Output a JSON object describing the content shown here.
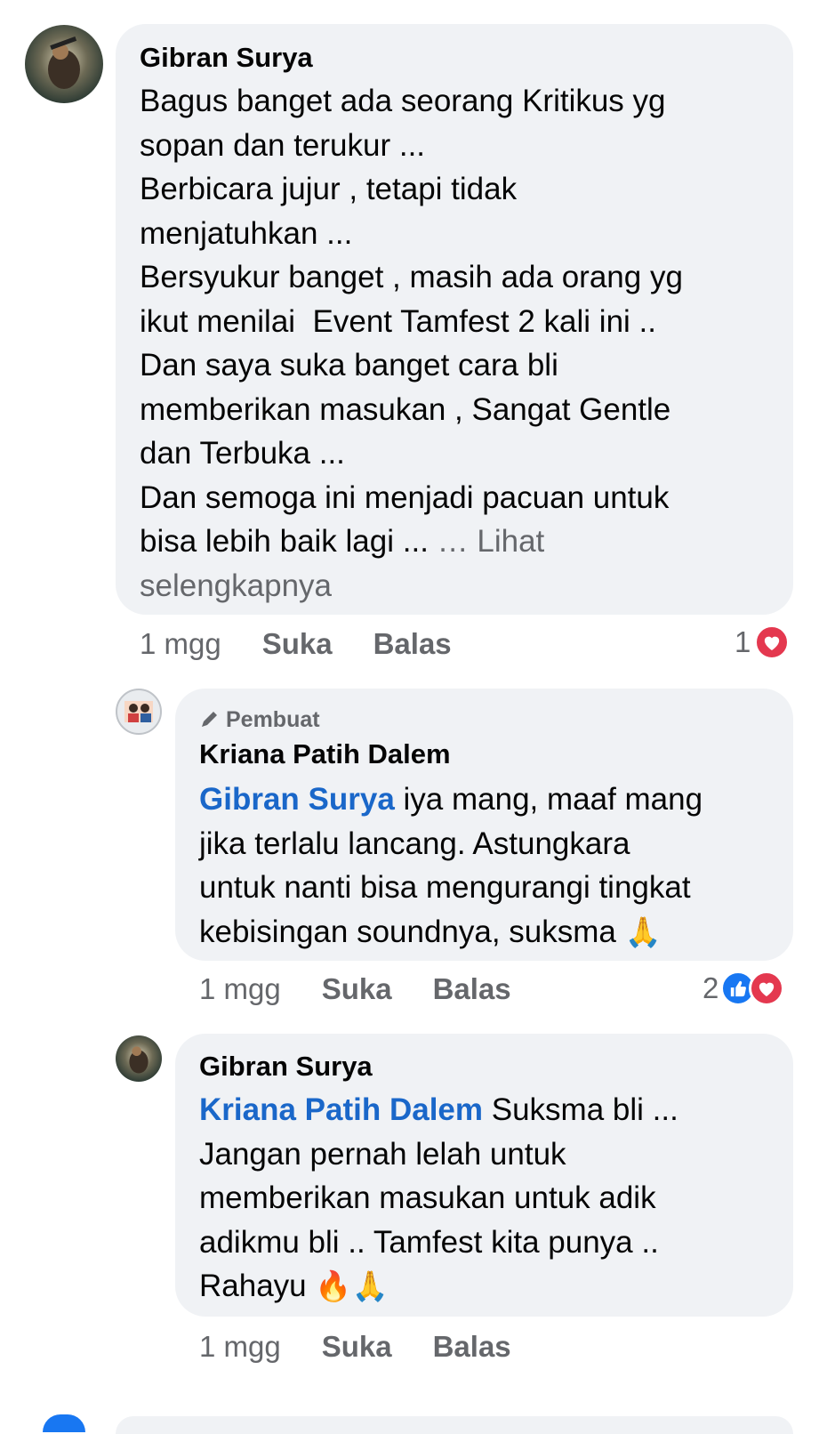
{
  "comments": [
    {
      "author": "Gibran Surya",
      "text": "Bagus banget ada seorang Kritikus yg\nsopan dan terukur ...\nBerbicara jujur , tetapi tidak\nmenjatuhkan ...\nBersyukur banget , masih ada orang yg\nikut menilai  Event Tamfest 2 kali ini ..\nDan saya suka banget cara bli\nmemberikan masukan , Sangat Gentle\ndan Terbuka ...\nDan semoga ini menjadi pacuan untuk\nbisa lebih baik lagi ... ",
      "see_more": "… Lihat\nselengkapnya",
      "time": "1 mgg",
      "like_label": "Suka",
      "reply_label": "Balas",
      "reaction_count": "1",
      "reactions": [
        "heart-icon"
      ]
    },
    {
      "creator_badge": "Pembuat",
      "author": "Kriana Patih Dalem",
      "mention": "Gibran Surya",
      "text": " iya mang, maaf mang\njika terlalu lancang. Astungkara\nuntuk nanti bisa mengurangi tingkat\nkebisingan soundnya, suksma ",
      "emoji": "🙏",
      "time": "1 mgg",
      "like_label": "Suka",
      "reply_label": "Balas",
      "reaction_count": "2",
      "reactions": [
        "like-icon",
        "heart-icon"
      ]
    },
    {
      "author": "Gibran Surya",
      "mention": "Kriana Patih Dalem",
      "text": " Suksma bli ...\nJangan pernah lelah untuk\nmemberikan masukan untuk adik\nadikmu bli .. Tamfest kita punya ..\nRahayu ",
      "emoji": "🔥🙏",
      "time": "1 mgg",
      "like_label": "Suka",
      "reply_label": "Balas"
    }
  ],
  "colors": {
    "bubble": "#f0f2f5",
    "mention": "#1a67c9",
    "muted": "#65676b",
    "heart": "#e4384f",
    "like": "#1877f2"
  }
}
